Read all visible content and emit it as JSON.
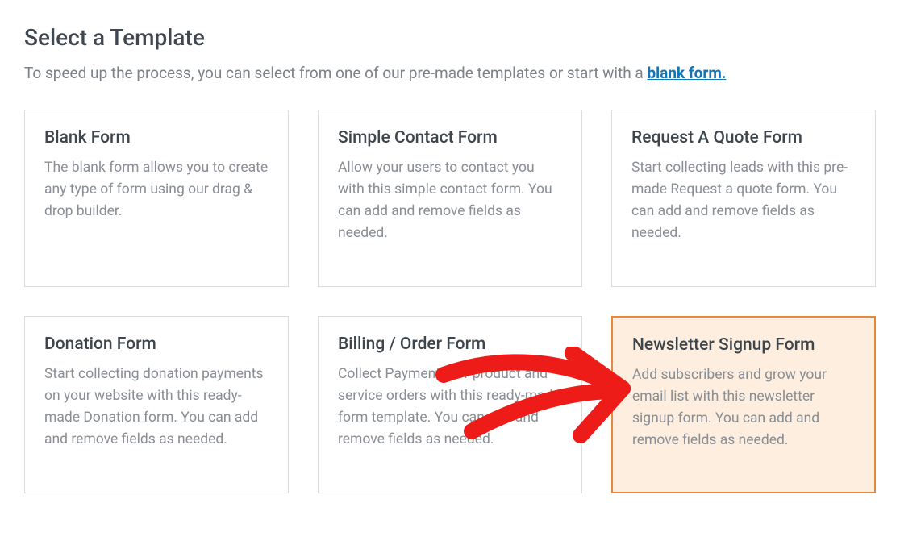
{
  "heading": "Select a Template",
  "subheading_prefix": "To speed up the process, you can select from one of our pre-made templates or start with a ",
  "subheading_link": "blank form.",
  "templates": [
    {
      "title": "Blank Form",
      "description": "The blank form allows you to create any type of form using our drag & drop builder."
    },
    {
      "title": "Simple Contact Form",
      "description": "Allow your users to contact you with this simple contact form. You can add and remove fields as needed."
    },
    {
      "title": "Request A Quote Form",
      "description": "Start collecting leads with this pre-made Request a quote form. You can add and remove fields as needed."
    },
    {
      "title": "Donation Form",
      "description": "Start collecting donation payments on your website with this ready-made Donation form. You can add and remove fields as needed."
    },
    {
      "title": "Billing / Order Form",
      "description": "Collect Payments for product and service orders with this ready-made form template. You can add and remove fields as needed."
    },
    {
      "title": "Newsletter Signup Form",
      "description": "Add subscribers and grow your email list with this newsletter signup form. You can add and remove fields as needed."
    }
  ],
  "highlighted_index": 5
}
